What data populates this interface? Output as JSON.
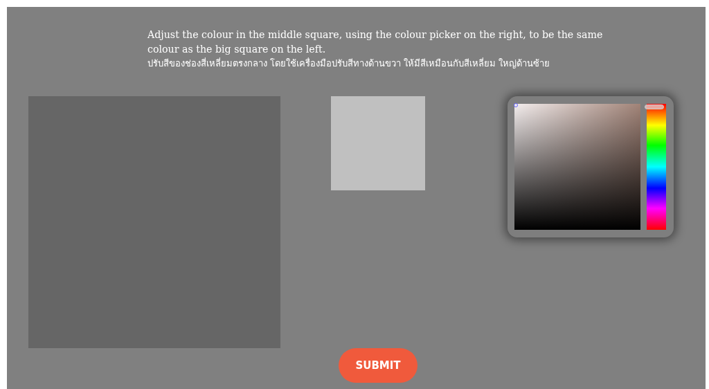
{
  "instructions": {
    "english": "Adjust the colour in the middle square, using the colour picker on the right, to be the same colour as the big square on the left.",
    "thai": "ปรับสีของช่องสี่เหลี่ยมตรงกลาง โดยใช้เครื่องมือปรับสีทางด้านขวา ให้มีสีเหมือนกับสีเหลี่ยม ใหญ่ด้านซ้าย"
  },
  "target_square": {
    "color": "#666666"
  },
  "current_square": {
    "color": "#c0c0c0"
  },
  "color_picker": {
    "hue_slider": {
      "level": 0.02
    }
  },
  "submit_button": {
    "label": "SUBMIT"
  }
}
